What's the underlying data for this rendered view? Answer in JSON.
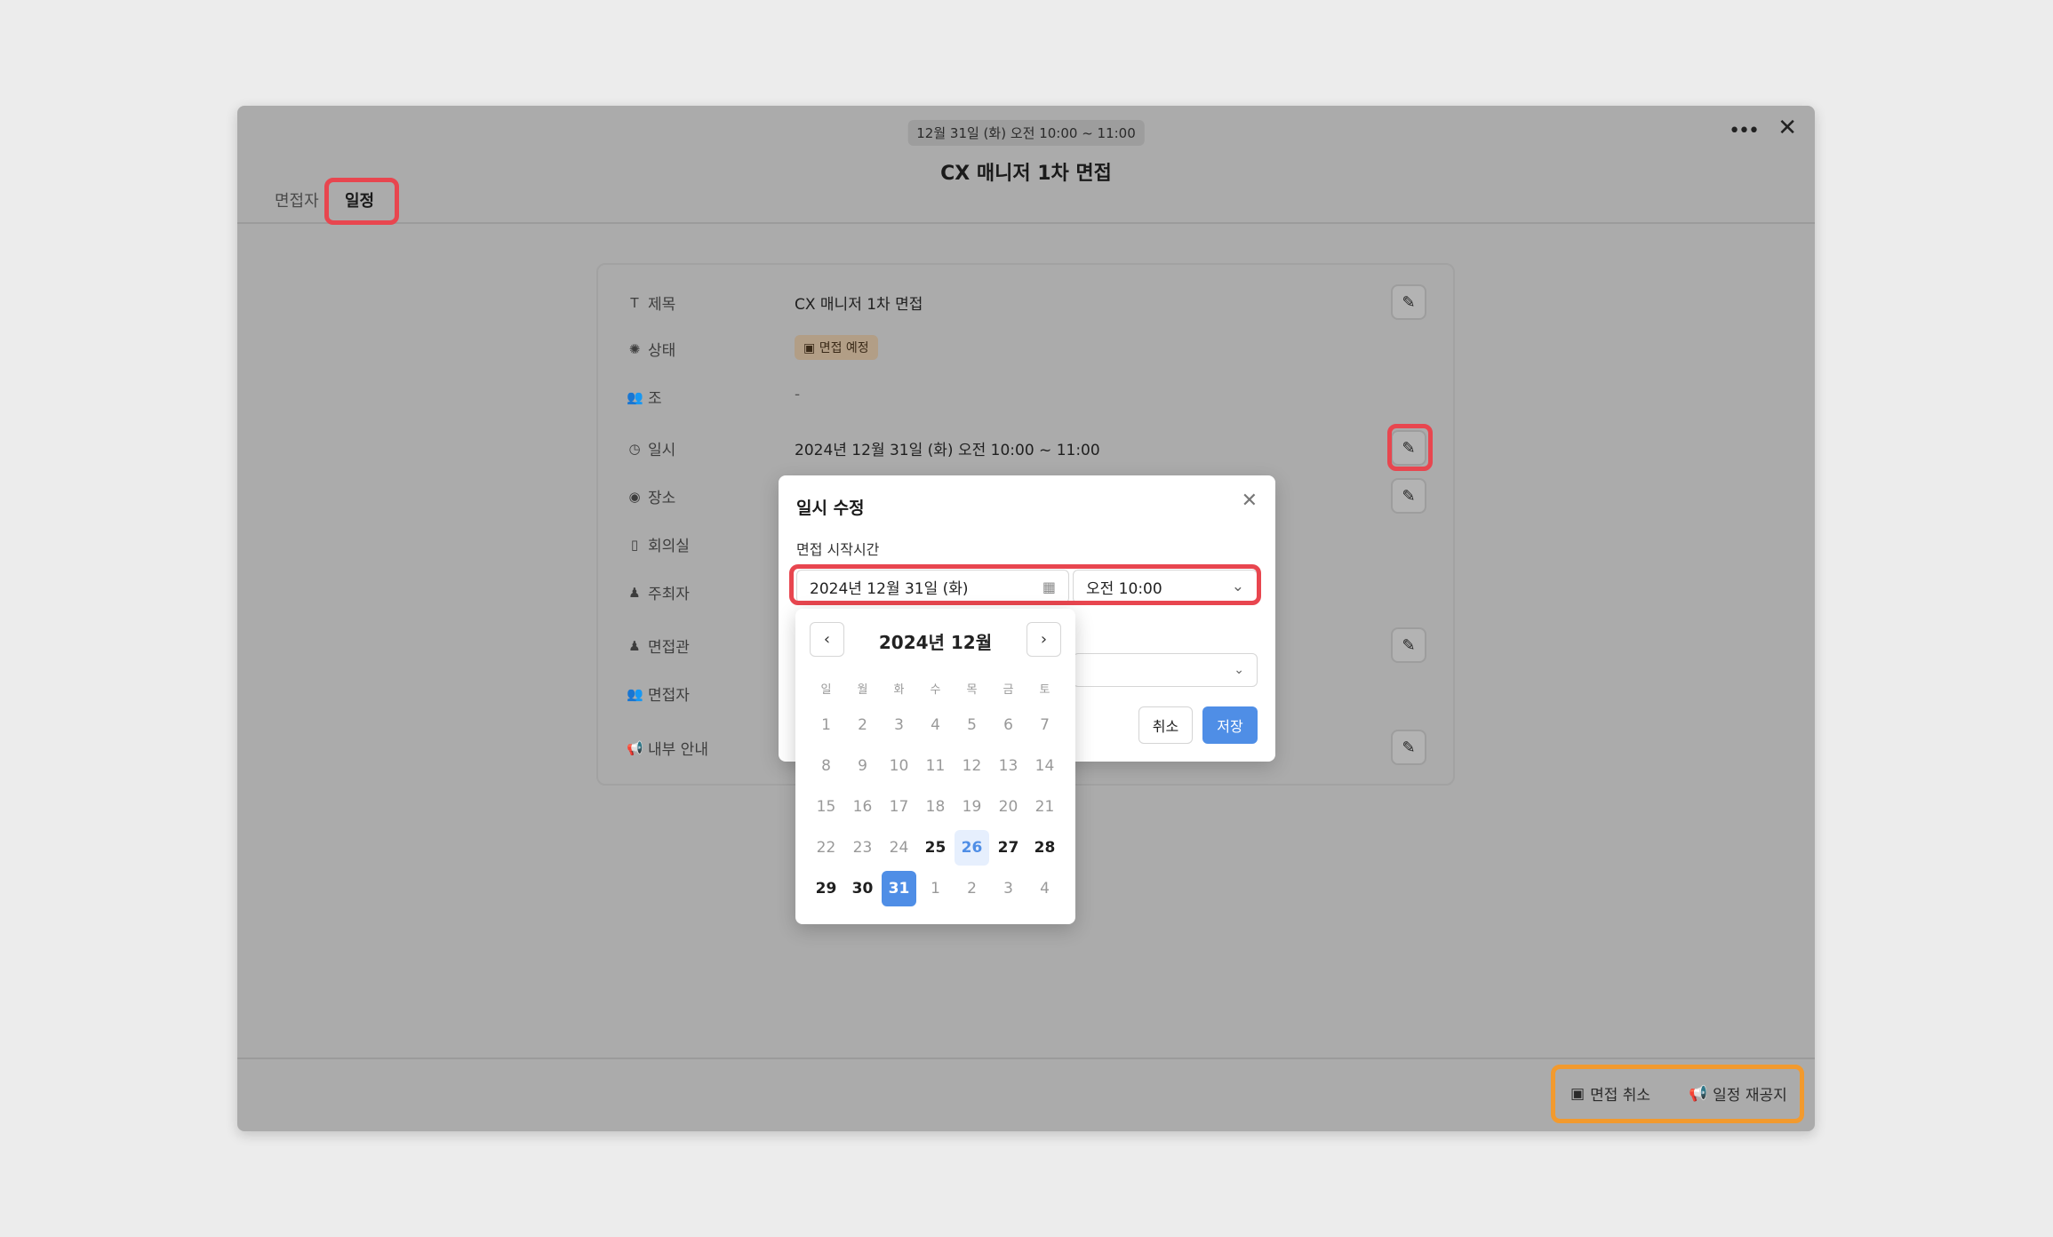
{
  "colors": {
    "background": "#ececec",
    "overlay": "#ababab",
    "accent": "#4f8ee6",
    "highlight_red": "#e8464f",
    "highlight_orange": "#f29a2e",
    "status_badge": "#b29e86"
  },
  "header": {
    "date_chip": "12월 31일 (화) 오전 10:00 ~ 11:00",
    "title": "CX 매니저 1차 면접",
    "more_icon": "more-horizontal-icon",
    "close_icon": "close-icon",
    "close_symbol": "✕",
    "more_symbol": "•••"
  },
  "tabs": [
    {
      "label": "면접자"
    },
    {
      "label": "일정"
    }
  ],
  "fields": {
    "title": {
      "icon": "T",
      "label": "제목",
      "value": "CX 매니저 1차 면접"
    },
    "status": {
      "icon": "✺",
      "label": "상태",
      "value": "면접 예정",
      "badge_icon": "calendar-icon"
    },
    "group": {
      "icon": "👥",
      "label": "조",
      "value": "-"
    },
    "datetime": {
      "icon": "◷",
      "label": "일시",
      "value": "2024년 12월 31일 (화) 오전 10:00 ~ 11:00"
    },
    "place": {
      "icon": "◉",
      "label": "장소"
    },
    "room": {
      "icon": "▯",
      "label": "회의실"
    },
    "host": {
      "icon": "♟",
      "label": "주최자"
    },
    "interviewer": {
      "icon": "♟",
      "label": "면접관"
    },
    "interviewee": {
      "icon": "👥",
      "label": "면접자"
    },
    "notice": {
      "icon": "📢",
      "label": "내부 안내"
    }
  },
  "edit_symbol": "✎",
  "footer": {
    "cancel_interview": "면접 취소",
    "renotify": "일정 재공지"
  },
  "modal": {
    "title": "일시 수정",
    "close_symbol": "✕",
    "start_label": "면접 시작시간",
    "date_value": "2024년 12월 31일 (화)",
    "time_value": "오전 10:00",
    "chevron": "⌄",
    "cancel": "취소",
    "save": "저장"
  },
  "calendar": {
    "month": "2024년 12월",
    "prev_symbol": "‹",
    "next_symbol": "›",
    "weekdays": [
      "일",
      "월",
      "화",
      "수",
      "목",
      "금",
      "토"
    ],
    "days": [
      {
        "d": "1",
        "s": "muted"
      },
      {
        "d": "2",
        "s": "muted"
      },
      {
        "d": "3",
        "s": "muted"
      },
      {
        "d": "4",
        "s": "muted"
      },
      {
        "d": "5",
        "s": "muted"
      },
      {
        "d": "6",
        "s": "muted"
      },
      {
        "d": "7",
        "s": "muted"
      },
      {
        "d": "8",
        "s": "muted"
      },
      {
        "d": "9",
        "s": "muted"
      },
      {
        "d": "10",
        "s": "muted"
      },
      {
        "d": "11",
        "s": "muted"
      },
      {
        "d": "12",
        "s": "muted"
      },
      {
        "d": "13",
        "s": "muted"
      },
      {
        "d": "14",
        "s": "muted"
      },
      {
        "d": "15",
        "s": "muted"
      },
      {
        "d": "16",
        "s": "muted"
      },
      {
        "d": "17",
        "s": "muted"
      },
      {
        "d": "18",
        "s": "muted"
      },
      {
        "d": "19",
        "s": "muted"
      },
      {
        "d": "20",
        "s": "muted"
      },
      {
        "d": "21",
        "s": "muted"
      },
      {
        "d": "22",
        "s": "muted"
      },
      {
        "d": "23",
        "s": "muted"
      },
      {
        "d": "24",
        "s": "muted"
      },
      {
        "d": "25",
        "s": "active"
      },
      {
        "d": "26",
        "s": "today"
      },
      {
        "d": "27",
        "s": "active"
      },
      {
        "d": "28",
        "s": "active"
      },
      {
        "d": "29",
        "s": "active"
      },
      {
        "d": "30",
        "s": "active"
      },
      {
        "d": "31",
        "s": "selected"
      },
      {
        "d": "1",
        "s": "muted"
      },
      {
        "d": "2",
        "s": "muted"
      },
      {
        "d": "3",
        "s": "muted"
      },
      {
        "d": "4",
        "s": "muted"
      }
    ]
  }
}
